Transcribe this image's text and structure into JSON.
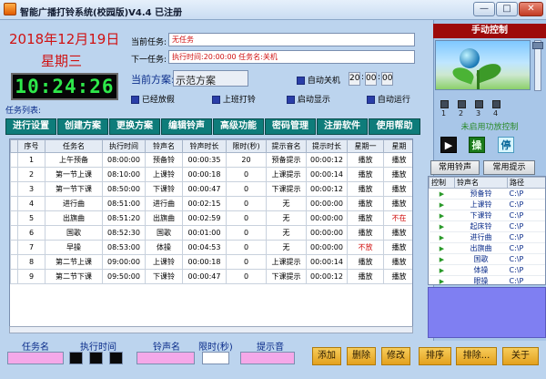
{
  "window": {
    "title": "智能广播打铃系统(校园版)V4.4 已注册",
    "min_label": "—",
    "max_label": "□",
    "close_label": "✕"
  },
  "clock": {
    "date": "2018年12月19日",
    "weekday": "星期三",
    "time": "10:24:26"
  },
  "tasks_info": {
    "current_label": "当前任务:",
    "current_value": "无任务",
    "next_label": "下一任务:",
    "next_value": "执行时间:20:00:00  任务名:关机"
  },
  "scheme": {
    "label": "当前方案:",
    "value": "示范方案"
  },
  "options": {
    "auto_shutdown": "自动关机",
    "shutdown_time": [
      "20",
      "00",
      "00"
    ],
    "holiday": "已经放假",
    "work_bell": "上班打铃",
    "startup_show": "启动显示",
    "auto_run": "自动运行"
  },
  "toolbar": {
    "task_list_label": "任务列表:",
    "buttons": [
      "进行设置",
      "创建方案",
      "更换方案",
      "编辑铃声",
      "高级功能",
      "密码管理",
      "注册软件",
      "使用帮助"
    ]
  },
  "table": {
    "headers": [
      "序号",
      "任务名",
      "执行时间",
      "铃声名",
      "铃声时长",
      "限时(秒)",
      "提示音名",
      "提示时长",
      "星期一",
      "星期"
    ],
    "rows": [
      [
        "1",
        "上午预备",
        "08:00:00",
        "预备铃",
        "00:00:35",
        "20",
        "预备提示",
        "00:00:12",
        "播放",
        "播放"
      ],
      [
        "2",
        "第一节上课",
        "08:10:00",
        "上课铃",
        "00:00:18",
        "0",
        "上课提示",
        "00:00:14",
        "播放",
        "播放"
      ],
      [
        "3",
        "第一节下课",
        "08:50:00",
        "下课铃",
        "00:00:47",
        "0",
        "下课提示",
        "00:00:12",
        "播放",
        "播放"
      ],
      [
        "4",
        "进行曲",
        "08:51:00",
        "进行曲",
        "00:02:15",
        "0",
        "无",
        "00:00:00",
        "播放",
        "播放"
      ],
      [
        "5",
        "出旗曲",
        "08:51:20",
        "出旗曲",
        "00:02:59",
        "0",
        "无",
        "00:00:00",
        "播放",
        "不在"
      ],
      [
        "6",
        "国歌",
        "08:52:30",
        "国歌",
        "00:01:00",
        "0",
        "无",
        "00:00:00",
        "播放",
        "播放"
      ],
      [
        "7",
        "早操",
        "08:53:00",
        "体操",
        "00:04:53",
        "0",
        "无",
        "00:00:00",
        "不放",
        "播放"
      ],
      [
        "8",
        "第二节上课",
        "09:00:00",
        "上课铃",
        "00:00:18",
        "0",
        "上课提示",
        "00:00:14",
        "播放",
        "播放"
      ],
      [
        "9",
        "第二节下课",
        "09:50:00",
        "下课铃",
        "00:00:47",
        "0",
        "下课提示",
        "00:00:12",
        "播放",
        "播放"
      ]
    ]
  },
  "edit_bar": {
    "task_name": "任务名",
    "exec_time": "执行时间",
    "ring_name": "铃声名",
    "limit": "限时(秒)",
    "prompt": "提示音",
    "buttons": [
      "添加",
      "删除",
      "修改",
      "排序",
      "排除...",
      "关于"
    ]
  },
  "manual": {
    "title": "手动控制",
    "channels": [
      "1",
      "2",
      "3",
      "4"
    ],
    "power_status": "未启用功放控制",
    "play_icon": "▶",
    "op_icon": "操",
    "stop_icon": "停",
    "common_ring_btn": "常用铃声",
    "common_prompt_btn": "常用提示",
    "list_headers": [
      "控制",
      "铃声名",
      "路径"
    ],
    "list_items": [
      {
        "name": "预备铃",
        "path": "C:\\P"
      },
      {
        "name": "上课铃",
        "path": "C:\\P"
      },
      {
        "name": "下课铃",
        "path": "C:\\P"
      },
      {
        "name": "起床铃",
        "path": "C:\\P"
      },
      {
        "name": "进行曲",
        "path": "C:\\P"
      },
      {
        "name": "出旗曲",
        "path": "C:\\P"
      },
      {
        "name": "国歌",
        "path": "C:\\P"
      },
      {
        "name": "体操",
        "path": "C:\\P"
      },
      {
        "name": "眼操",
        "path": "C:\\P"
      }
    ]
  },
  "colors": {
    "date_red": "#d01212",
    "clock_green": "#2ee84a",
    "toolbar_teal": "#0e7c7a",
    "panel_title_red": "#9d0a0a",
    "action_orange": "#e3a11e"
  }
}
